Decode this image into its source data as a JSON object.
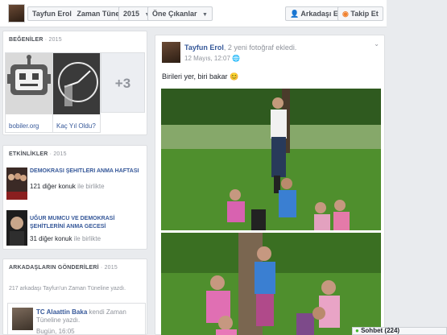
{
  "topbar": {
    "name_crumb": "Tayfun Erol",
    "timeline_crumb": "Zaman Tüneli",
    "year_crumb": "2015",
    "filter_crumb": "Öne Çıkanlar",
    "add_friend": "Arkadaşı Ekle",
    "follow": "Takip Et"
  },
  "likes": {
    "heading": "BEĞENİLER",
    "year": "· 2015",
    "items": [
      {
        "label": "bobiler.org",
        "icon": "robot-icon"
      },
      {
        "label": "Kaç Yıl Oldu?",
        "icon": "clock-icon"
      }
    ],
    "more": "+3"
  },
  "events": {
    "heading": "ETKİNLİKLER",
    "year": "· 2015",
    "items": [
      {
        "title": "Demokrasi Şehitleri Anma Haftası",
        "guests": "121 diğer konuk",
        "suffix": "ile birlikte"
      },
      {
        "title": "UĞUR MUMCU VE DEMOKRASİ ŞEHİTLERİNİ ANMA GECESİ",
        "guests": "31 diğer konuk",
        "suffix": "ile birlikte"
      }
    ]
  },
  "friend_posts": {
    "heading": "ARKADAŞLARIN GÖNDERİLERİ",
    "year": "· 2015",
    "summary": "217 arkadaşı Tayfun'un Zaman Tüneline yazdı.",
    "post": {
      "author": "TC Alaattin Baka",
      "text": "kendi Zaman Tüneline yazdı.",
      "time": "Bugün, 16:05"
    }
  },
  "post": {
    "author": "Tayfun Erol",
    "action": ", 2 yeni fotoğraf ekledi.",
    "date": "12 Mayıs, 12:07",
    "text": "Birileri yer, biri bakar 😊"
  },
  "chat": {
    "label": "Sohbet (224)"
  }
}
